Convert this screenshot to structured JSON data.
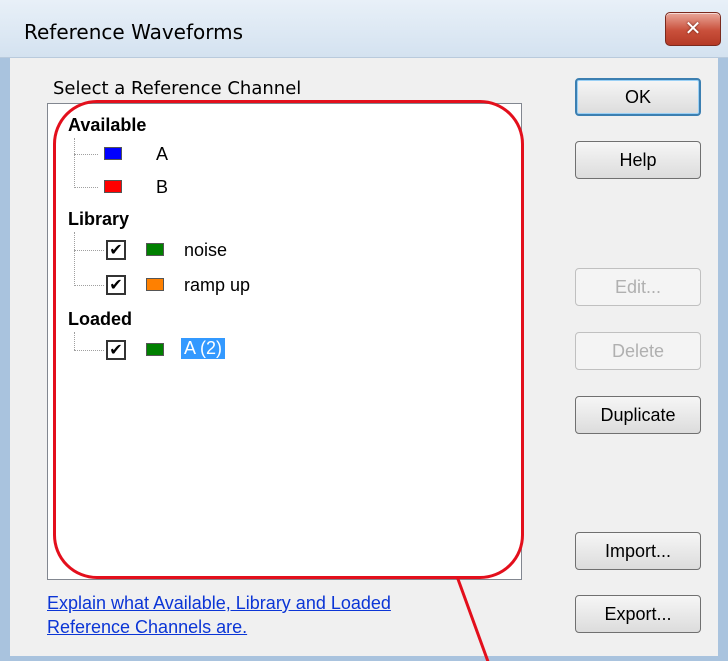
{
  "window": {
    "title": "Reference Waveforms",
    "close_glyph": "✕"
  },
  "group": {
    "label": "Select a Reference Channel"
  },
  "tree": {
    "available": {
      "header": "Available",
      "items": [
        {
          "label": "A",
          "color": "#0000ff"
        },
        {
          "label": "B",
          "color": "#ff0000"
        }
      ]
    },
    "library": {
      "header": "Library",
      "items": [
        {
          "label": "noise",
          "color": "#008000",
          "checked": true
        },
        {
          "label": "ramp up",
          "color": "#ff8000",
          "checked": true
        }
      ]
    },
    "loaded": {
      "header": "Loaded",
      "items": [
        {
          "label": "A (2)",
          "color": "#008000",
          "checked": true,
          "selected": true
        }
      ]
    },
    "check_glyph": "✔"
  },
  "buttons": {
    "ok": "OK",
    "help": "Help",
    "edit": "Edit...",
    "delete": "Delete",
    "duplicate": "Duplicate",
    "import": "Import...",
    "export": "Export..."
  },
  "help_link": {
    "line1": "Explain what Available, Library and Loaded",
    "line2": "Reference Channels are."
  },
  "annotation_color": "#e30f1c"
}
